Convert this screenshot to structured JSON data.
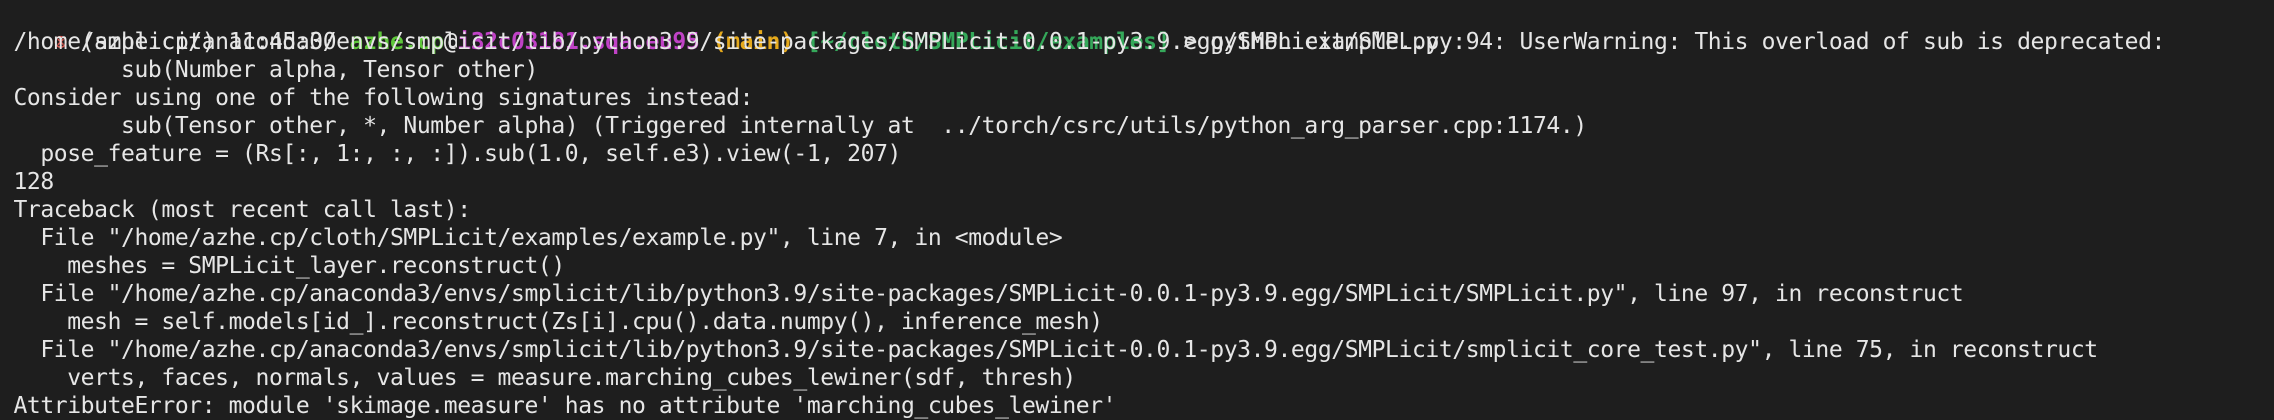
{
  "colors": {
    "background": "#1e1e1e",
    "text": "#e6e6e6",
    "prompt_x": "#d4564e",
    "user": "#5ec73a",
    "host": "#c042c6",
    "branch": "#e5a91c",
    "path": "#35a85a"
  },
  "prompt": {
    "status_icon": "⊗",
    "env_time": " (smplicit) 11:45:00 ",
    "user": "azhe.cp",
    "at": "@",
    "host": "i32c03181.sqa.eu95",
    "space1": " ",
    "branch": "(main)",
    "space2": " ",
    "path": "[~/cloth/SMPLicit/examples]",
    "arrow": " > ",
    "command": "python example.py"
  },
  "output": [
    " /home/azhe.cp/anaconda3/envs/smplicit/lib/python3.9/site-packages/SMPLicit-0.0.1-py3.9.egg/SMPLicit/SMPL.py:94: UserWarning: This overload of sub is deprecated:",
    "         sub(Number alpha, Tensor other)",
    " Consider using one of the following signatures instead:",
    "         sub(Tensor other, *, Number alpha) (Triggered internally at  ../torch/csrc/utils/python_arg_parser.cpp:1174.)",
    "   pose_feature = (Rs[:, 1:, :, :]).sub(1.0, self.e3).view(-1, 207)",
    " 128",
    " Traceback (most recent call last):",
    "   File \"/home/azhe.cp/cloth/SMPLicit/examples/example.py\", line 7, in <module>",
    "     meshes = SMPLicit_layer.reconstruct()",
    "   File \"/home/azhe.cp/anaconda3/envs/smplicit/lib/python3.9/site-packages/SMPLicit-0.0.1-py3.9.egg/SMPLicit/SMPLicit.py\", line 97, in reconstruct",
    "     mesh = self.models[id_].reconstruct(Zs[i].cpu().data.numpy(), inference_mesh)",
    "   File \"/home/azhe.cp/anaconda3/envs/smplicit/lib/python3.9/site-packages/SMPLicit-0.0.1-py3.9.egg/SMPLicit/smplicit_core_test.py\", line 75, in reconstruct",
    "     verts, faces, normals, values = measure.marching_cubes_lewiner(sdf, thresh)",
    " AttributeError: module 'skimage.measure' has no attribute 'marching_cubes_lewiner'"
  ]
}
